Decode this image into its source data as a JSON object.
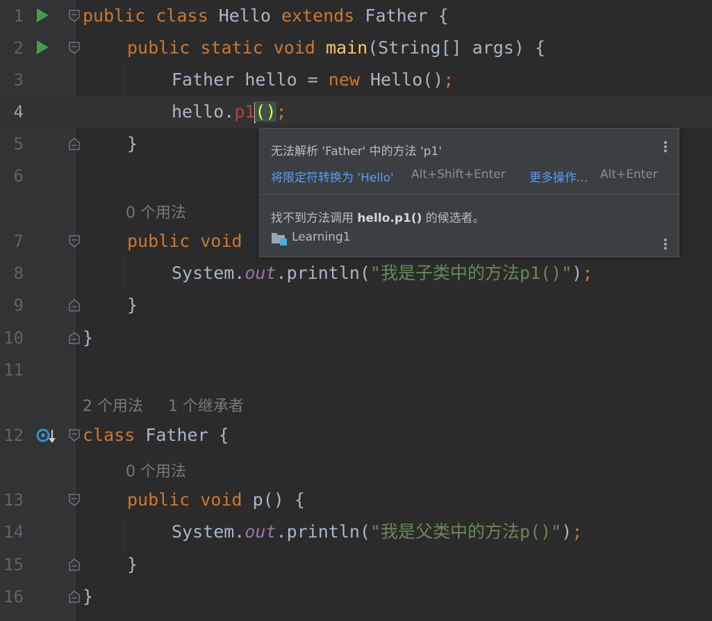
{
  "editor": {
    "lines": [
      {
        "num": "1"
      },
      {
        "num": "2"
      },
      {
        "num": "3"
      },
      {
        "num": "4"
      },
      {
        "num": "5"
      },
      {
        "num": "6"
      },
      {
        "num": "7"
      },
      {
        "num": "8"
      },
      {
        "num": "9"
      },
      {
        "num": "10"
      },
      {
        "num": "11"
      },
      {
        "num": "12"
      },
      {
        "num": "13"
      },
      {
        "num": "14"
      },
      {
        "num": "15"
      },
      {
        "num": "16"
      }
    ],
    "tokens": {
      "l1_public": "public",
      "l1_class": "class",
      "l1_hello": " Hello ",
      "l1_extends": "extends",
      "l1_father": " Father {",
      "l2_mods": "public static void ",
      "l2_main": "main",
      "l2_sig": "(String[] args) {",
      "l3_a": "Father hello = ",
      "l3_new": "new",
      "l3_b": " Hello()",
      "l3_semi": ";",
      "l4_a": "hello.",
      "l4_p1": "p1",
      "l4_paren": "()",
      "l4_semi": ";",
      "brace_close": "}",
      "l7_mods": "public void ",
      "l8_a": "System.",
      "l8_out": "out",
      "l8_b": ".println(",
      "l8_str": "\"我是子类中的方法p1()\"",
      "l8_c": ")",
      "l8_semi": ";",
      "l12_class": "class",
      "l12_rest": " Father {",
      "l13_mods": "public void ",
      "l13_p": "p() {",
      "l14_a": "System.",
      "l14_out": "out",
      "l14_b": ".println(",
      "l14_str": "\"我是父类中的方法p()\"",
      "l14_c": ")",
      "l14_semi": ";"
    },
    "hints": {
      "usages_0_a": "0 个用法",
      "usages_2": "2 个用法",
      "inheritors_1": "1 个继承者",
      "usages_0_b": "0 个用法"
    }
  },
  "popup": {
    "error_message": "无法解析 'Father' 中的方法 'p1'",
    "fix_action": "将限定符转换为 'Hello'",
    "fix_shortcut": "Alt+Shift+Enter",
    "more_actions": "更多操作...",
    "more_shortcut": "Alt+Enter",
    "detail_prefix": "找不到方法调用 ",
    "detail_code": "hello.p1()",
    "detail_suffix": " 的候选者。",
    "module_name": "Learning1"
  },
  "colors": {
    "background": "#2b2b2b",
    "keyword": "#cc7832",
    "method_decl": "#ffc66d",
    "string": "#6a8759",
    "static_field": "#9876aa",
    "error": "#bc3f3c",
    "link": "#589df6"
  },
  "icons": [
    "run-icon",
    "fold-icon",
    "implemented-icon",
    "folder-module-icon",
    "more-menu-icon"
  ]
}
